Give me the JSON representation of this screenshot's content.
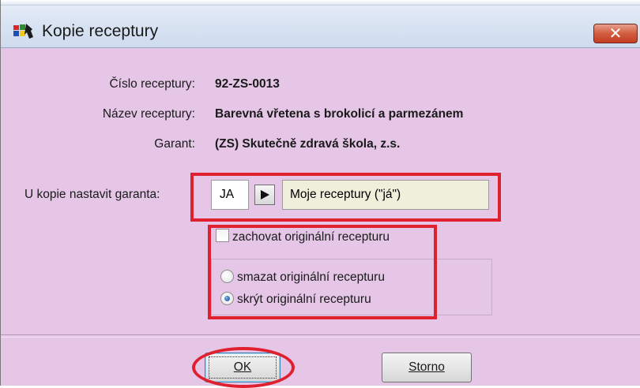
{
  "window": {
    "title": "Kopie receptury",
    "close_label": "✕"
  },
  "info": {
    "cislo_label": "Číslo receptury:",
    "cislo_value": "92-ZS-0013",
    "nazev_label": "Název receptury:",
    "nazev_value": "Barevná vřetena s brokolicí a parmezánem",
    "garant_label": "Garant:",
    "garant_value": "(ZS) Skutečně zdravá škola, z.s."
  },
  "garant_select": {
    "label": "U kopie nastavit garanta:",
    "code": "JA",
    "name": "Moje receptury (\"já\")"
  },
  "options": {
    "keep_original": {
      "label": "zachovat originální recepturu",
      "checked": false
    },
    "radios": [
      {
        "label": "smazat originální recepturu",
        "selected": false
      },
      {
        "label": "skrýt originální recepturu",
        "selected": true
      }
    ]
  },
  "buttons": {
    "ok": "OK",
    "storno": "Storno"
  },
  "colors": {
    "window_bg": "#e5c6e7",
    "highlight_red": "#e0202e",
    "close_red": "#c33d22"
  }
}
